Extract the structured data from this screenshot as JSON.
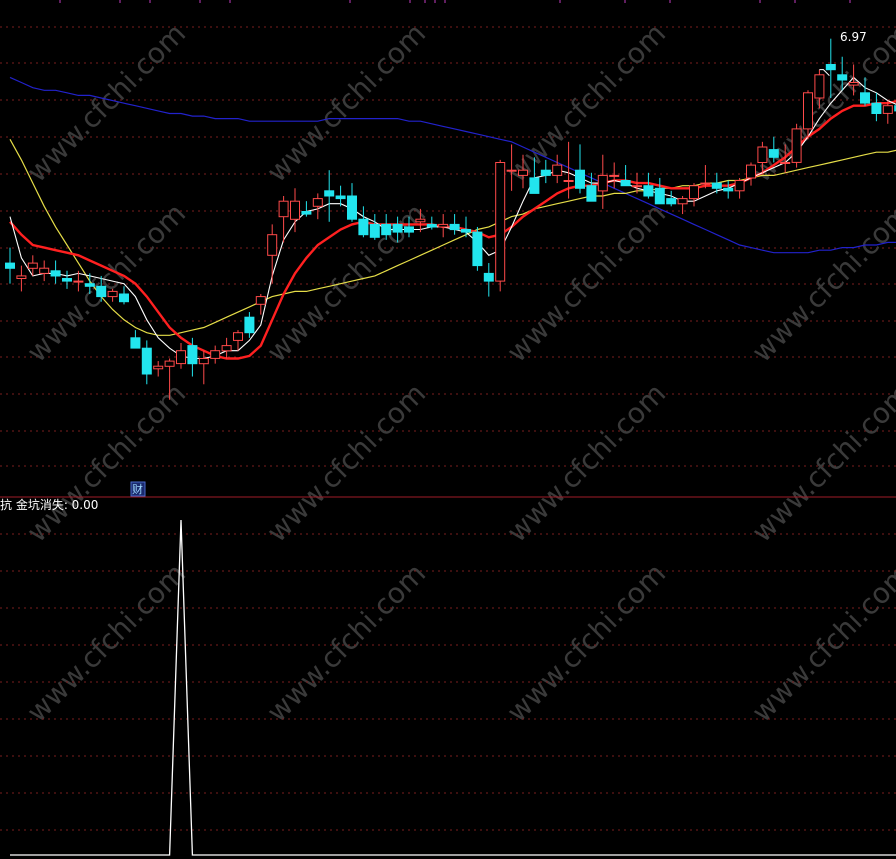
{
  "colors": {
    "background": "#000000",
    "grid": "#7a1e1e",
    "divider": "#a01c28",
    "up_candle": "#ff4a4a",
    "down_candle": "#22e5ee",
    "ma_white": "#ffffff",
    "ma_red": "#ff2020",
    "ma_yellow": "#e5dd48",
    "ma_blue": "#2222cc",
    "indicator": "#ffffff"
  },
  "watermark": "www.cfchi.com",
  "top_panel": {
    "price_label": "6.97",
    "badge_label": "财"
  },
  "bottom_panel": {
    "indicator_label": "抗  金坑消失: 0.00"
  },
  "chart_data": [
    {
      "type": "candlestick",
      "ylim": [
        5.2,
        7.1
      ],
      "grid": true,
      "high_label": "6.97",
      "ohlc": [
        [
          6.08,
          6.14,
          6.0,
          6.06
        ],
        [
          6.02,
          6.07,
          5.97,
          6.03
        ],
        [
          6.06,
          6.11,
          6.03,
          6.08
        ],
        [
          6.04,
          6.09,
          6.01,
          6.06
        ],
        [
          6.05,
          6.09,
          6.0,
          6.03
        ],
        [
          6.02,
          6.05,
          5.98,
          6.01
        ],
        [
          6.01,
          6.05,
          5.97,
          6.01
        ],
        [
          6.0,
          6.04,
          5.96,
          5.99
        ],
        [
          5.99,
          6.03,
          5.93,
          5.95
        ],
        [
          5.95,
          5.98,
          5.93,
          5.97
        ],
        [
          5.96,
          5.99,
          5.92,
          5.93
        ],
        [
          5.79,
          5.82,
          5.75,
          5.75
        ],
        [
          5.75,
          5.78,
          5.61,
          5.65
        ],
        [
          5.67,
          5.7,
          5.64,
          5.68
        ],
        [
          5.68,
          5.71,
          5.55,
          5.7
        ],
        [
          5.69,
          5.77,
          5.67,
          5.74
        ],
        [
          5.76,
          5.79,
          5.64,
          5.69
        ],
        [
          5.69,
          5.74,
          5.61,
          5.71
        ],
        [
          5.71,
          5.76,
          5.69,
          5.74
        ],
        [
          5.74,
          5.79,
          5.71,
          5.76
        ],
        [
          5.78,
          5.82,
          5.74,
          5.81
        ],
        [
          5.87,
          5.89,
          5.79,
          5.81
        ],
        [
          5.92,
          5.96,
          5.88,
          5.95
        ],
        [
          6.11,
          6.23,
          6.0,
          6.19
        ],
        [
          6.26,
          6.34,
          6.16,
          6.32
        ],
        [
          6.25,
          6.37,
          6.2,
          6.32
        ],
        [
          6.28,
          6.32,
          6.26,
          6.27
        ],
        [
          6.3,
          6.35,
          6.25,
          6.33
        ],
        [
          6.36,
          6.44,
          6.24,
          6.34
        ],
        [
          6.34,
          6.38,
          6.3,
          6.33
        ],
        [
          6.34,
          6.39,
          6.24,
          6.25
        ],
        [
          6.25,
          6.3,
          6.18,
          6.19
        ],
        [
          6.23,
          6.27,
          6.17,
          6.18
        ],
        [
          6.23,
          6.27,
          6.17,
          6.19
        ],
        [
          6.23,
          6.26,
          6.16,
          6.2
        ],
        [
          6.22,
          6.26,
          6.18,
          6.2
        ],
        [
          6.24,
          6.29,
          6.2,
          6.25
        ],
        [
          6.23,
          6.26,
          6.21,
          6.22
        ],
        [
          6.22,
          6.27,
          6.18,
          6.23
        ],
        [
          6.23,
          6.27,
          6.19,
          6.21
        ],
        [
          6.21,
          6.26,
          6.18,
          6.2
        ],
        [
          6.2,
          6.22,
          6.05,
          6.07
        ],
        [
          6.04,
          6.08,
          5.95,
          6.01
        ],
        [
          6.01,
          6.48,
          5.97,
          6.47
        ],
        [
          6.44,
          6.54,
          6.36,
          6.44
        ],
        [
          6.42,
          6.5,
          6.37,
          6.44
        ],
        [
          6.41,
          6.49,
          6.35,
          6.35
        ],
        [
          6.44,
          6.48,
          6.39,
          6.42
        ],
        [
          6.42,
          6.5,
          6.39,
          6.46
        ],
        [
          6.4,
          6.55,
          6.33,
          6.4
        ],
        [
          6.44,
          6.54,
          6.35,
          6.37
        ],
        [
          6.38,
          6.43,
          6.32,
          6.32
        ],
        [
          6.36,
          6.5,
          6.29,
          6.42
        ],
        [
          6.42,
          6.47,
          6.37,
          6.42
        ],
        [
          6.4,
          6.46,
          6.38,
          6.38
        ],
        [
          6.38,
          6.43,
          6.35,
          6.38
        ],
        [
          6.38,
          6.43,
          6.33,
          6.34
        ],
        [
          6.37,
          6.41,
          6.31,
          6.31
        ],
        [
          6.33,
          6.36,
          6.3,
          6.31
        ],
        [
          6.31,
          6.34,
          6.27,
          6.33
        ],
        [
          6.33,
          6.39,
          6.3,
          6.38
        ],
        [
          6.39,
          6.46,
          6.37,
          6.39
        ],
        [
          6.39,
          6.43,
          6.35,
          6.37
        ],
        [
          6.37,
          6.4,
          6.33,
          6.36
        ],
        [
          6.36,
          6.41,
          6.33,
          6.4
        ],
        [
          6.41,
          6.47,
          6.38,
          6.46
        ],
        [
          6.47,
          6.55,
          6.43,
          6.53
        ],
        [
          6.52,
          6.57,
          6.47,
          6.49
        ],
        [
          6.47,
          6.54,
          6.43,
          6.47
        ],
        [
          6.47,
          6.62,
          6.45,
          6.6
        ],
        [
          6.6,
          6.75,
          6.56,
          6.74
        ],
        [
          6.72,
          6.83,
          6.68,
          6.81
        ],
        [
          6.85,
          6.95,
          6.72,
          6.83
        ],
        [
          6.81,
          6.88,
          6.75,
          6.79
        ],
        [
          6.77,
          6.85,
          6.73,
          6.78
        ],
        [
          6.74,
          6.8,
          6.69,
          6.7
        ],
        [
          6.7,
          6.74,
          6.63,
          6.66
        ],
        [
          6.66,
          6.71,
          6.62,
          6.69
        ],
        [
          6.69,
          6.73,
          6.65,
          6.67
        ],
        [
          6.68,
          6.72,
          6.63,
          6.66
        ]
      ],
      "ma_white": [
        6.26,
        6.1,
        6.03,
        6.04,
        6.04,
        6.03,
        6.04,
        6.03,
        6.02,
        6.01,
        6.0,
        5.95,
        5.86,
        5.79,
        5.75,
        5.72,
        5.71,
        5.71,
        5.72,
        5.74,
        5.74,
        5.78,
        5.84,
        6.03,
        6.17,
        6.24,
        6.28,
        6.29,
        6.31,
        6.31,
        6.29,
        6.26,
        6.24,
        6.21,
        6.21,
        6.21,
        6.21,
        6.22,
        6.22,
        6.21,
        6.2,
        6.16,
        6.11,
        6.13,
        6.22,
        6.32,
        6.41,
        6.42,
        6.44,
        6.43,
        6.41,
        6.39,
        6.39,
        6.4,
        6.39,
        6.37,
        6.36,
        6.35,
        6.34,
        6.32,
        6.32,
        6.34,
        6.36,
        6.37,
        6.39,
        6.41,
        6.43,
        6.45,
        6.47,
        6.51,
        6.57,
        6.64,
        6.7,
        6.75,
        6.8,
        6.76,
        6.74,
        6.71,
        6.69,
        6.68
      ],
      "ma_red": [
        6.24,
        6.19,
        6.15,
        6.14,
        6.13,
        6.12,
        6.11,
        6.09,
        6.07,
        6.05,
        6.03,
        6.0,
        5.95,
        5.89,
        5.83,
        5.79,
        5.76,
        5.74,
        5.72,
        5.71,
        5.71,
        5.72,
        5.76,
        5.86,
        5.96,
        6.04,
        6.1,
        6.15,
        6.18,
        6.21,
        6.23,
        6.24,
        6.23,
        6.23,
        6.23,
        6.23,
        6.23,
        6.23,
        6.22,
        6.22,
        6.21,
        6.2,
        6.18,
        6.19,
        6.22,
        6.26,
        6.29,
        6.32,
        6.35,
        6.37,
        6.38,
        6.38,
        6.39,
        6.4,
        6.4,
        6.39,
        6.39,
        6.38,
        6.37,
        6.37,
        6.37,
        6.38,
        6.38,
        6.38,
        6.39,
        6.41,
        6.43,
        6.46,
        6.49,
        6.53,
        6.57,
        6.6,
        6.64,
        6.67,
        6.69,
        6.69,
        6.7,
        6.7,
        6.71,
        6.71
      ],
      "ma_yellow": [
        6.56,
        6.48,
        6.39,
        6.3,
        6.22,
        6.15,
        6.08,
        6.01,
        5.95,
        5.9,
        5.86,
        5.83,
        5.81,
        5.8,
        5.8,
        5.81,
        5.82,
        5.83,
        5.85,
        5.87,
        5.89,
        5.91,
        5.93,
        5.95,
        5.96,
        5.97,
        5.97,
        5.98,
        5.99,
        6.0,
        6.01,
        6.02,
        6.03,
        6.05,
        6.07,
        6.09,
        6.11,
        6.13,
        6.15,
        6.17,
        6.19,
        6.21,
        6.22,
        6.24,
        6.26,
        6.27,
        6.29,
        6.3,
        6.31,
        6.32,
        6.33,
        6.34,
        6.34,
        6.35,
        6.35,
        6.36,
        6.36,
        6.37,
        6.37,
        6.38,
        6.38,
        6.39,
        6.39,
        6.4,
        6.4,
        6.41,
        6.42,
        6.42,
        6.43,
        6.44,
        6.45,
        6.46,
        6.47,
        6.48,
        6.49,
        6.5,
        6.51,
        6.51,
        6.52,
        6.52
      ],
      "ma_blue": [
        6.8,
        6.78,
        6.76,
        6.75,
        6.75,
        6.74,
        6.73,
        6.73,
        6.72,
        6.71,
        6.7,
        6.69,
        6.68,
        6.67,
        6.66,
        6.66,
        6.65,
        6.65,
        6.64,
        6.64,
        6.64,
        6.63,
        6.63,
        6.63,
        6.63,
        6.63,
        6.63,
        6.63,
        6.64,
        6.64,
        6.64,
        6.64,
        6.64,
        6.64,
        6.64,
        6.63,
        6.63,
        6.62,
        6.61,
        6.6,
        6.59,
        6.58,
        6.57,
        6.56,
        6.55,
        6.53,
        6.51,
        6.49,
        6.47,
        6.45,
        6.43,
        6.41,
        6.39,
        6.37,
        6.35,
        6.33,
        6.31,
        6.29,
        6.27,
        6.25,
        6.23,
        6.21,
        6.19,
        6.17,
        6.15,
        6.14,
        6.13,
        6.12,
        6.12,
        6.12,
        6.12,
        6.13,
        6.13,
        6.14,
        6.14,
        6.15,
        6.15,
        6.16,
        6.16,
        6.17
      ]
    },
    {
      "type": "line",
      "label": "金坑消失",
      "current_value": "0.00",
      "ylim": [
        0,
        1
      ],
      "values": [
        0,
        0,
        0,
        0,
        0,
        0,
        0,
        0,
        0,
        0,
        0,
        0,
        0,
        0,
        0,
        1,
        0,
        0,
        0,
        0,
        0,
        0,
        0,
        0,
        0,
        0,
        0,
        0,
        0,
        0,
        0,
        0,
        0,
        0,
        0,
        0,
        0,
        0,
        0,
        0,
        0,
        0,
        0,
        0,
        0,
        0,
        0,
        0,
        0,
        0,
        0,
        0,
        0,
        0,
        0,
        0,
        0,
        0,
        0,
        0,
        0,
        0,
        0,
        0,
        0,
        0,
        0,
        0,
        0,
        0,
        0,
        0,
        0,
        0,
        0,
        0,
        0,
        0,
        0,
        0
      ]
    }
  ]
}
